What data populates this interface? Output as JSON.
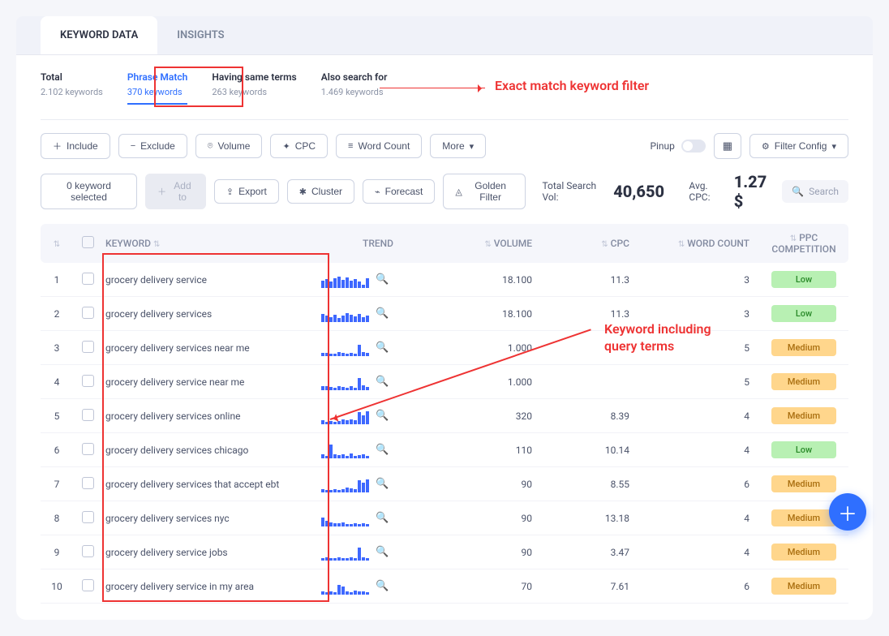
{
  "tabs": {
    "keyword_data": "KEYWORD DATA",
    "insights": "INSIGHTS"
  },
  "filters": [
    {
      "label": "Total",
      "sub": "2.102 keywords",
      "active": false
    },
    {
      "label": "Phrase Match",
      "sub": "370 keywords",
      "active": true
    },
    {
      "label": "Having same terms",
      "sub": "263 keywords",
      "active": false
    },
    {
      "label": "Also search for",
      "sub": "1.469 keywords",
      "active": false
    }
  ],
  "annotations": {
    "exact_match": "Exact match keyword filter",
    "including_terms": "Keyword including\nquery terms"
  },
  "toolbar": {
    "include": "Include",
    "exclude": "Exclude",
    "volume": "Volume",
    "cpc": "CPC",
    "word_count": "Word Count",
    "more": "More",
    "pinup": "Pinup",
    "filter_config": "Filter Config"
  },
  "actionbar": {
    "selected": "0 keyword selected",
    "add_to": "Add to",
    "export": "Export",
    "cluster": "Cluster",
    "forecast": "Forecast",
    "golden": "Golden Filter",
    "search_vol_label": "Total Search Vol:",
    "search_vol": "40,650",
    "avg_cpc_label": "Avg. CPC:",
    "avg_cpc": "1.27 $",
    "search_placeholder": "Search"
  },
  "columns": {
    "keyword": "KEYWORD",
    "trend": "TREND",
    "volume": "VOLUME",
    "cpc": "CPC",
    "word_count": "WORD COUNT",
    "ppc": "PPC COMPETITION"
  },
  "rows": [
    {
      "n": 1,
      "kw": "grocery delivery service",
      "vol": "18.100",
      "cpc": "11.3",
      "wc": "3",
      "ppc": "Low",
      "bars": [
        9,
        11,
        8,
        12,
        14,
        10,
        13,
        9,
        11,
        8,
        4,
        12
      ]
    },
    {
      "n": 2,
      "kw": "grocery delivery services",
      "vol": "18.100",
      "cpc": "11.3",
      "wc": "3",
      "ppc": "Low",
      "bars": [
        10,
        8,
        6,
        9,
        5,
        8,
        11,
        9,
        7,
        10,
        6,
        8
      ]
    },
    {
      "n": 3,
      "kw": "grocery delivery services near me",
      "vol": "1.000",
      "cpc": "",
      "wc": "5",
      "ppc": "Medium",
      "bars": [
        4,
        4,
        3,
        3,
        5,
        4,
        3,
        4,
        3,
        14,
        5,
        4
      ]
    },
    {
      "n": 4,
      "kw": "grocery delivery service near me",
      "vol": "1.000",
      "cpc": "",
      "wc": "5",
      "ppc": "Medium",
      "bars": [
        5,
        5,
        4,
        3,
        5,
        4,
        3,
        5,
        3,
        15,
        6,
        4
      ]
    },
    {
      "n": 5,
      "kw": "grocery delivery services online",
      "vol": "320",
      "cpc": "8.39",
      "wc": "4",
      "ppc": "Medium",
      "bars": [
        5,
        3,
        4,
        3,
        4,
        6,
        5,
        6,
        5,
        15,
        11,
        16
      ]
    },
    {
      "n": 6,
      "kw": "grocery delivery services chicago",
      "vol": "110",
      "cpc": "10.14",
      "wc": "4",
      "ppc": "Low",
      "bars": [
        5,
        3,
        17,
        5,
        4,
        5,
        3,
        6,
        3,
        4,
        5,
        3
      ]
    },
    {
      "n": 7,
      "kw": "grocery delivery services that accept ebt",
      "vol": "90",
      "cpc": "8.55",
      "wc": "6",
      "ppc": "Medium",
      "bars": [
        4,
        3,
        3,
        4,
        3,
        4,
        6,
        5,
        4,
        15,
        12,
        16
      ]
    },
    {
      "n": 8,
      "kw": "grocery delivery services nyc",
      "vol": "90",
      "cpc": "13.18",
      "wc": "4",
      "ppc": "Medium",
      "bars": [
        11,
        7,
        5,
        4,
        4,
        5,
        3,
        3,
        4,
        3,
        4,
        3
      ]
    },
    {
      "n": 9,
      "kw": "grocery delivery service jobs",
      "vol": "90",
      "cpc": "3.47",
      "wc": "4",
      "ppc": "Medium",
      "bars": [
        3,
        4,
        3,
        3,
        4,
        3,
        3,
        4,
        3,
        16,
        4,
        3
      ]
    },
    {
      "n": 10,
      "kw": "grocery delivery service in my area",
      "vol": "70",
      "cpc": "7.61",
      "wc": "6",
      "ppc": "Medium",
      "bars": [
        4,
        3,
        4,
        3,
        12,
        10,
        4,
        3,
        5,
        4,
        4,
        3
      ]
    }
  ]
}
